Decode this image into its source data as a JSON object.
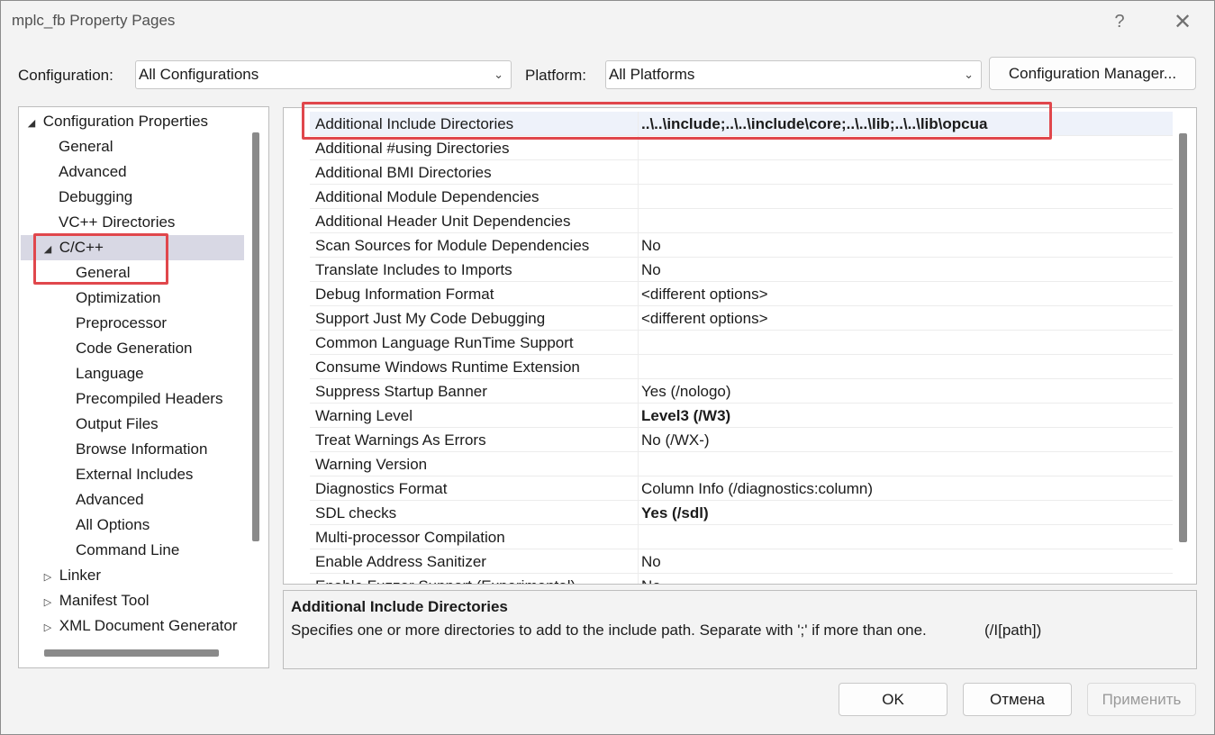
{
  "window": {
    "title": "mplc_fb Property Pages",
    "help_label": "?",
    "close_label": "✕"
  },
  "toolbar": {
    "configuration_label": "Configuration:",
    "configuration_value": "All Configurations",
    "platform_label": "Platform:",
    "platform_value": "All Platforms",
    "config_manager_label": "Configuration Manager..."
  },
  "tree": {
    "root": "Configuration Properties",
    "items": [
      {
        "label": "General"
      },
      {
        "label": "Advanced"
      },
      {
        "label": "Debugging"
      },
      {
        "label": "VC++ Directories"
      }
    ],
    "cpp": {
      "label": "C/C++",
      "children": [
        {
          "label": "General"
        },
        {
          "label": "Optimization"
        },
        {
          "label": "Preprocessor"
        },
        {
          "label": "Code Generation"
        },
        {
          "label": "Language"
        },
        {
          "label": "Precompiled Headers"
        },
        {
          "label": "Output Files"
        },
        {
          "label": "Browse Information"
        },
        {
          "label": "External Includes"
        },
        {
          "label": "Advanced"
        },
        {
          "label": "All Options"
        },
        {
          "label": "Command Line"
        }
      ]
    },
    "collapsed": [
      {
        "label": "Linker"
      },
      {
        "label": "Manifest Tool"
      },
      {
        "label": "XML Document Generator"
      }
    ]
  },
  "properties": [
    {
      "name": "Additional Include Directories",
      "value": "..\\..\\include;..\\..\\include\\core;..\\..\\lib;..\\..\\lib\\opcua",
      "bold": true
    },
    {
      "name": "Additional #using Directories",
      "value": "",
      "bold": false
    },
    {
      "name": "Additional BMI Directories",
      "value": "",
      "bold": false
    },
    {
      "name": "Additional Module Dependencies",
      "value": "",
      "bold": false
    },
    {
      "name": "Additional Header Unit Dependencies",
      "value": "",
      "bold": false
    },
    {
      "name": "Scan Sources for Module Dependencies",
      "value": "No",
      "bold": false
    },
    {
      "name": "Translate Includes to Imports",
      "value": "No",
      "bold": false
    },
    {
      "name": "Debug Information Format",
      "value": "<different options>",
      "bold": false
    },
    {
      "name": "Support Just My Code Debugging",
      "value": "<different options>",
      "bold": false
    },
    {
      "name": "Common Language RunTime Support",
      "value": "",
      "bold": false
    },
    {
      "name": "Consume Windows Runtime Extension",
      "value": "",
      "bold": false
    },
    {
      "name": "Suppress Startup Banner",
      "value": "Yes (/nologo)",
      "bold": false
    },
    {
      "name": "Warning Level",
      "value": "Level3 (/W3)",
      "bold": true
    },
    {
      "name": "Treat Warnings As Errors",
      "value": "No (/WX-)",
      "bold": false
    },
    {
      "name": "Warning Version",
      "value": "",
      "bold": false
    },
    {
      "name": "Diagnostics Format",
      "value": "Column Info (/diagnostics:column)",
      "bold": false
    },
    {
      "name": "SDL checks",
      "value": "Yes (/sdl)",
      "bold": true
    },
    {
      "name": "Multi-processor Compilation",
      "value": "",
      "bold": false
    },
    {
      "name": "Enable Address Sanitizer",
      "value": "No",
      "bold": false
    },
    {
      "name": "Enable Fuzzer Support (Experimental)",
      "value": "No",
      "bold": false
    }
  ],
  "description": {
    "title": "Additional Include Directories",
    "text": "Specifies one or more directories to add to the include path. Separate with ';' if more than one.",
    "switch": "(/I[path])"
  },
  "buttons": {
    "ok": "OK",
    "cancel": "Отмена",
    "apply": "Применить"
  },
  "colors": {
    "highlight": "#e0474c",
    "selected_row": "#d8d8e4"
  },
  "icons": {
    "expanded": "▲",
    "collapsed": "▷",
    "dropdown": "⌵"
  }
}
